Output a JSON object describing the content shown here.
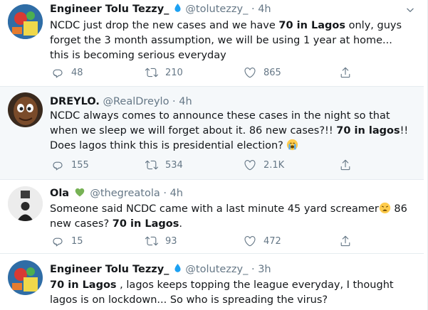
{
  "tweets": [
    {
      "name": "Engineer Tolu Tezzy_",
      "handle": "@tolutezzy_",
      "dot": "·",
      "time": "4h",
      "text_parts": [
        "NCDC just drop the new cases and we have ",
        "70 in Lagos",
        " only, guys forget the 3 month assumption,  we will be using 1 year at home... this is becoming serious everyday"
      ],
      "replies": "48",
      "retweets": "210",
      "likes": "865"
    },
    {
      "name": "DREYLO.",
      "handle": "@RealDreylo",
      "dot": "·",
      "time": "4h",
      "text_parts": [
        "NCDC always comes to announce these cases in the night so that when we sleep we will forget about it. 86 new cases?!! ",
        "70 in lagos",
        "!! Does lagos think this is presidential election? "
      ],
      "replies": "155",
      "retweets": "534",
      "likes": "2.1K"
    },
    {
      "name": "Ola",
      "handle": "@thegreatola",
      "dot": "·",
      "time": "4h",
      "text_parts": [
        "Someone said NCDC came with a last minute 45 yard screamer",
        " 86 new cases? ",
        "70 in Lagos",
        "."
      ],
      "replies": "15",
      "retweets": "93",
      "likes": "472"
    },
    {
      "name": "Engineer Tolu Tezzy_",
      "handle": "@tolutezzy_",
      "dot": "·",
      "time": "3h",
      "text_parts": [
        "70 in Lagos",
        " , lagos keeps topping the league everyday, I thought lagos is on lockdown... So who is spreading the virus?"
      ]
    }
  ],
  "colors": {
    "verified": "#1da1f2",
    "muted": "#657786",
    "highlight_bg": "#f5f8fa",
    "green_heart": "#77b255"
  }
}
